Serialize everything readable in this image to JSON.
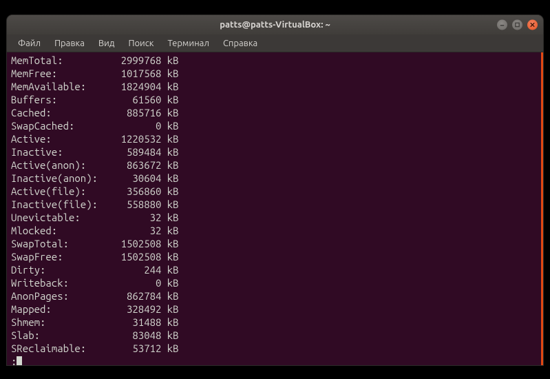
{
  "window": {
    "title": "patts@patts-VirtualBox: ~"
  },
  "menubar": {
    "items": [
      "Файл",
      "Правка",
      "Вид",
      "Поиск",
      "Терминал",
      "Справка"
    ]
  },
  "meminfo": [
    {
      "label": "MemTotal:",
      "value": "2999768",
      "unit": "kB"
    },
    {
      "label": "MemFree:",
      "value": "1017568",
      "unit": "kB"
    },
    {
      "label": "MemAvailable:",
      "value": "1824904",
      "unit": "kB"
    },
    {
      "label": "Buffers:",
      "value": "61560",
      "unit": "kB"
    },
    {
      "label": "Cached:",
      "value": "885716",
      "unit": "kB"
    },
    {
      "label": "SwapCached:",
      "value": "0",
      "unit": "kB"
    },
    {
      "label": "Active:",
      "value": "1220532",
      "unit": "kB"
    },
    {
      "label": "Inactive:",
      "value": "589484",
      "unit": "kB"
    },
    {
      "label": "Active(anon):",
      "value": "863672",
      "unit": "kB"
    },
    {
      "label": "Inactive(anon):",
      "value": "30604",
      "unit": "kB"
    },
    {
      "label": "Active(file):",
      "value": "356860",
      "unit": "kB"
    },
    {
      "label": "Inactive(file):",
      "value": "558880",
      "unit": "kB"
    },
    {
      "label": "Unevictable:",
      "value": "32",
      "unit": "kB"
    },
    {
      "label": "Mlocked:",
      "value": "32",
      "unit": "kB"
    },
    {
      "label": "SwapTotal:",
      "value": "1502508",
      "unit": "kB"
    },
    {
      "label": "SwapFree:",
      "value": "1502508",
      "unit": "kB"
    },
    {
      "label": "Dirty:",
      "value": "244",
      "unit": "kB"
    },
    {
      "label": "Writeback:",
      "value": "0",
      "unit": "kB"
    },
    {
      "label": "AnonPages:",
      "value": "862784",
      "unit": "kB"
    },
    {
      "label": "Mapped:",
      "value": "328492",
      "unit": "kB"
    },
    {
      "label": "Shmem:",
      "value": "31488",
      "unit": "kB"
    },
    {
      "label": "Slab:",
      "value": "83048",
      "unit": "kB"
    },
    {
      "label": "SReclaimable:",
      "value": "53712",
      "unit": "kB"
    }
  ],
  "prompt": ":"
}
